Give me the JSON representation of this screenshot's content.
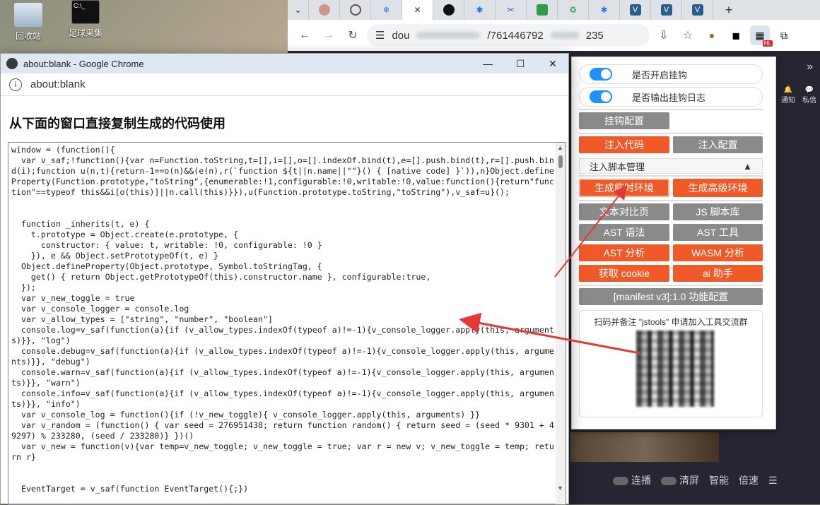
{
  "desktop": {
    "icons": [
      {
        "label": "回收站"
      },
      {
        "label": "足球采集"
      }
    ]
  },
  "browser": {
    "address_prefix": "dou",
    "address_suffix": "/761446792",
    "address_tail": "235",
    "new_tab": "+"
  },
  "page_side": {
    "notify": "通知",
    "messages": "私信"
  },
  "player": {
    "items": [
      "连播",
      "清屏",
      "智能",
      "倍速"
    ]
  },
  "popup_window": {
    "title": "about:blank - Google Chrome",
    "address": "about:blank",
    "heading": "从下面的窗口直接复制生成的代码使用",
    "code": "window = (function(){\n  var v_saf;!function(){var n=Function.toString,t=[],i=[],o=[].indexOf.bind(t),e=[].push.bind(t),r=[].push.bind(i);function u(n,t){return-1==o(n)&&(e(n),r(`function ${t||n.name||\"\"}() { [native code] }`)),n}Object.defineProperty(Function.prototype,\"toString\",{enumerable:!1,configurable:!0,writable:!0,value:function(){return\"function\"==typeof this&&i[o(this)]||n.call(this)}}),u(Function.prototype.toString,\"toString\"),v_saf=u}();\n\n\n  function _inherits(t, e) {\n    t.prototype = Object.create(e.prototype, {\n      constructor: { value: t, writable: !0, configurable: !0 }\n    }), e && Object.setPrototypeOf(t, e) }\n  Object.defineProperty(Object.prototype, Symbol.toStringTag, {\n    get() { return Object.getPrototypeOf(this).constructor.name }, configurable:true,\n  });\n  var v_new_toggle = true\n  var v_console_logger = console.log\n  var v_allow_types = [\"string\", \"number\", \"boolean\"]\n  console.log=v_saf(function(a){if (v_allow_types.indexOf(typeof a)!=-1){v_console_logger.apply(this, arguments)}}, \"log\")\n  console.debug=v_saf(function(a){if (v_allow_types.indexOf(typeof a)!=-1){v_console_logger.apply(this, arguments)}}, \"debug\")\n  console.warn=v_saf(function(a){if (v_allow_types.indexOf(typeof a)!=-1){v_console_logger.apply(this, arguments)}}, \"warn\")\n  console.info=v_saf(function(a){if (v_allow_types.indexOf(typeof a)!=-1){v_console_logger.apply(this, arguments)}}, \"info\")\n  var v_console_log = function(){if (!v_new_toggle){ v_console_logger.apply(this, arguments) }}\n  var v_random = (function() { var seed = 276951438; return function random() { return seed = (seed * 9301 + 49297) % 233280, (seed / 233280)} })()\n  var v_new = function(v){var temp=v_new_toggle; v_new_toggle = true; var r = new v; v_new_toggle = temp; return r}\n\n\n  EventTarget = v_saf(function EventTarget(){;})"
  },
  "extension": {
    "switch_hook": "是否开启挂钩",
    "switch_log": "是否输出挂钩日志",
    "hook_config": "挂钩配置",
    "inject_code": "注入代码",
    "inject_config": "注入配置",
    "inject_manager": "注入脚本管理",
    "inject_manager_arrow": "▲",
    "gen_temp_env": "生成临时环境",
    "gen_adv_env": "生成高级环境",
    "text_diff": "文本对比页",
    "js_lib": "JS 脚本库",
    "ast_syntax": "AST 语法",
    "ast_tool": "AST 工具",
    "ast_analysis": "AST 分析",
    "wasm_analysis": "WASM 分析",
    "get_cookie": "获取 cookie",
    "ai_helper": "ai 助手",
    "manifest": "[manifest v3]:1.0 功能配置",
    "qr_caption": "扫码并备注 \"jstools\" 申请加入工具交流群",
    "badge": "HL"
  },
  "colors": {
    "orange": "#f05a28",
    "gray": "#8a8a8a",
    "switch_blue": "#1e90ff",
    "arrow_red": "#e53935"
  }
}
